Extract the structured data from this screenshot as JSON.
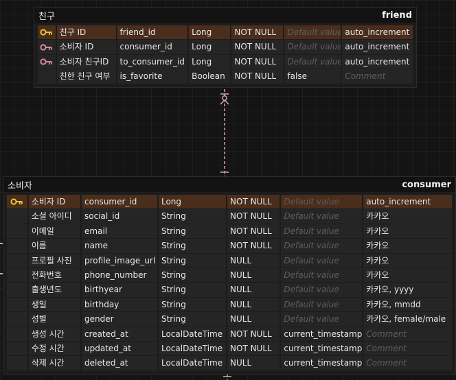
{
  "entities": {
    "friend": {
      "logical_name": "친구",
      "physical_name": "friend",
      "columns": [
        {
          "key": "pk",
          "logical": "친구 ID",
          "physical": "friend_id",
          "type": "Long",
          "nullable": "NOT NULL",
          "default": "Default value",
          "default_placeholder": true,
          "comment": "auto_increment",
          "comment_placeholder": false
        },
        {
          "key": "fk",
          "logical": "소비자 ID",
          "physical": "consumer_id",
          "type": "Long",
          "nullable": "NOT NULL",
          "default": "Default value",
          "default_placeholder": true,
          "comment": "auto_increment",
          "comment_placeholder": false
        },
        {
          "key": "fk",
          "logical": "소비자 친구ID",
          "physical": "to_consumer_id",
          "type": "Long",
          "nullable": "NOT NULL",
          "default": "Default value",
          "default_placeholder": true,
          "comment": "auto_increment",
          "comment_placeholder": false
        },
        {
          "key": "",
          "logical": "친한 친구 여부",
          "physical": "is_favorite",
          "type": "Boolean",
          "nullable": "NOT NULL",
          "default": "false",
          "default_placeholder": false,
          "comment": "Comment",
          "comment_placeholder": true
        }
      ]
    },
    "consumer": {
      "logical_name": "소비자",
      "physical_name": "consumer",
      "columns": [
        {
          "key": "pk",
          "logical": "소비자 ID",
          "physical": "consumer_id",
          "type": "Long",
          "nullable": "NOT NULL",
          "default": "Default value",
          "default_placeholder": true,
          "comment": "auto_increment",
          "comment_placeholder": false
        },
        {
          "key": "",
          "logical": "소셜 아이디",
          "physical": "social_id",
          "type": "String",
          "nullable": "NOT NULL",
          "default": "Default value",
          "default_placeholder": true,
          "comment": "카카오",
          "comment_placeholder": false
        },
        {
          "key": "",
          "logical": "이메일",
          "physical": "email",
          "type": "String",
          "nullable": "NOT NULL",
          "default": "Default value",
          "default_placeholder": true,
          "comment": "카카오",
          "comment_placeholder": false
        },
        {
          "key": "",
          "logical": "이름",
          "physical": "name",
          "type": "String",
          "nullable": "NOT NULL",
          "default": "Default value",
          "default_placeholder": true,
          "comment": "카카오",
          "comment_placeholder": false
        },
        {
          "key": "",
          "logical": "프로필 사진",
          "physical": "profile_image_url",
          "type": "String",
          "nullable": "NULL",
          "default": "Default value",
          "default_placeholder": true,
          "comment": "카카오",
          "comment_placeholder": false
        },
        {
          "key": "",
          "logical": "전화번호",
          "physical": "phone_number",
          "type": "String",
          "nullable": "NULL",
          "default": "Default value",
          "default_placeholder": true,
          "comment": "카카오",
          "comment_placeholder": false
        },
        {
          "key": "",
          "logical": "출생년도",
          "physical": "birthyear",
          "type": "String",
          "nullable": "NULL",
          "default": "Default value",
          "default_placeholder": true,
          "comment": "카카오, yyyy",
          "comment_placeholder": false
        },
        {
          "key": "",
          "logical": "생일",
          "physical": "birthday",
          "type": "String",
          "nullable": "NULL",
          "default": "Default value",
          "default_placeholder": true,
          "comment": "카카오, mmdd",
          "comment_placeholder": false
        },
        {
          "key": "",
          "logical": "성별",
          "physical": "gender",
          "type": "String",
          "nullable": "NULL",
          "default": "Default value",
          "default_placeholder": true,
          "comment": "카카오, female/male",
          "comment_placeholder": false
        },
        {
          "key": "",
          "logical": "생성 시간",
          "physical": "created_at",
          "type": "LocalDateTime",
          "nullable": "NOT NULL",
          "default": "current_timestamp",
          "default_placeholder": false,
          "comment": "Comment",
          "comment_placeholder": true
        },
        {
          "key": "",
          "logical": "수정 시간",
          "physical": "updated_at",
          "type": "LocalDateTime",
          "nullable": "NOT NULL",
          "default": "current_timestamp",
          "default_placeholder": false,
          "comment": "Comment",
          "comment_placeholder": true
        },
        {
          "key": "",
          "logical": "삭제 시간",
          "physical": "deleted_at",
          "type": "LocalDateTime",
          "nullable": "NULL",
          "default": "current_timestamp",
          "default_placeholder": false,
          "comment": "Comment",
          "comment_placeholder": true
        }
      ]
    }
  },
  "relationship": {
    "from": "consumer",
    "to": "friend",
    "style": "one-to-many, dashed"
  },
  "colors": {
    "pk_key": "#e8c53a",
    "fk_key": "#d78a9a",
    "pk_row": "#4a2e1b",
    "relation_line": "#d8a7a7"
  }
}
